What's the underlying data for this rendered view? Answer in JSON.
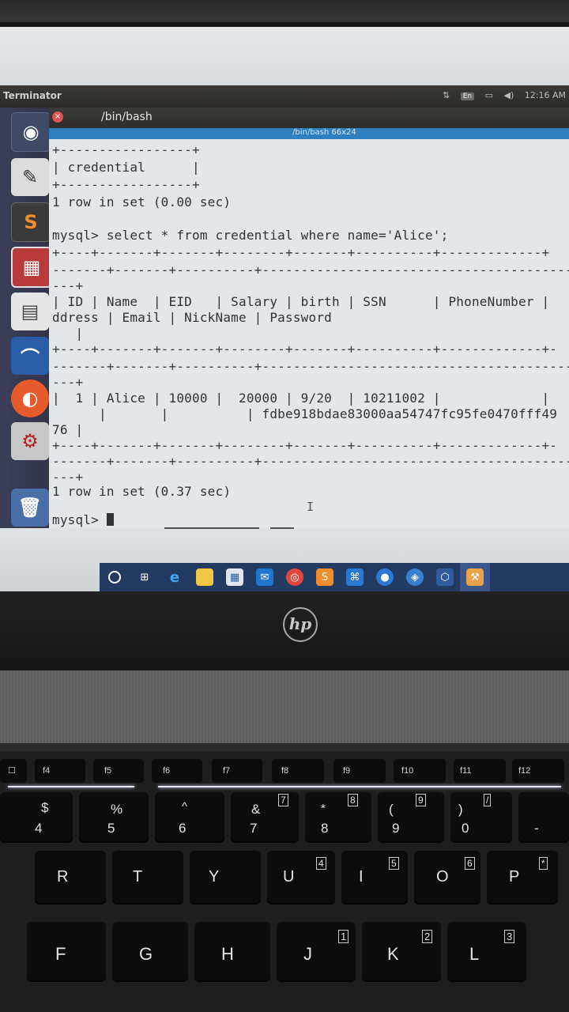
{
  "topbar": {
    "app_title": "Terminator",
    "lang_badge": "En",
    "clock": "12:16 AM"
  },
  "window": {
    "title": "/bin/bash",
    "inner_title": "/bin/bash 66x24"
  },
  "terminal": {
    "lines": [
      "+-----------------+",
      "| credential      |",
      "+-----------------+",
      "1 row in set (0.00 sec)",
      "",
      "mysql> select * from credential where name='Alice';",
      "+----+-------+-------+--------+-------+----------+-------------+",
      "-------+-------+----------+------------------------------------------",
      "---+",
      "| ID | Name  | EID   | Salary | birth | SSN      | PhoneNumber |",
      "ddress | Email | NickName | Password",
      "   |",
      "+----+-------+-------+--------+-------+----------+-------------+-",
      "-------+-------+----------+------------------------------------------",
      "---+",
      "|  1 | Alice | 10000 |  20000 | 9/20  | 10211002 |             |",
      "      |       |          | fdbe918bdae83000aa54747fc95fe0470fff49",
      "76 |",
      "+----+-------+-------+--------+-------+----------+-------------+-",
      "-------+-------+----------+------------------------------------------",
      "---+",
      "1 row in set (0.37 sec)",
      "",
      "mysql> "
    ]
  },
  "laptop": {
    "brand": "hp"
  },
  "keyboard": {
    "fkeys": [
      "f4",
      "f5",
      "f6",
      "f7",
      "f8",
      "f9",
      "f10",
      "f11",
      "f12"
    ],
    "num_row": [
      {
        "top": "$",
        "main": "4"
      },
      {
        "top": "%",
        "main": "5"
      },
      {
        "top": "^",
        "main": "6"
      },
      {
        "top": "&",
        "main": "7",
        "pad": "7"
      },
      {
        "top": "*",
        "main": "8",
        "pad": "8"
      },
      {
        "top": "(",
        "main": "9",
        "pad": "9"
      },
      {
        "top": ")",
        "main": "0",
        "pad": "/"
      },
      {
        "top": "",
        "main": "-"
      }
    ],
    "row2": [
      {
        "main": "R"
      },
      {
        "main": "T"
      },
      {
        "main": "Y"
      },
      {
        "main": "U",
        "pad": "4"
      },
      {
        "main": "I",
        "pad": "5"
      },
      {
        "main": "O",
        "pad": "6"
      },
      {
        "main": "P",
        "pad": "*"
      }
    ],
    "row3": [
      {
        "main": "F"
      },
      {
        "main": "G"
      },
      {
        "main": "H"
      },
      {
        "main": "J",
        "pad": "1"
      },
      {
        "main": "K",
        "pad": "2"
      },
      {
        "main": "L",
        "pad": "3"
      }
    ]
  },
  "colors": {
    "launcher": "#33364d",
    "taskbar": "#233a63",
    "terminal_bg": "#e4e7e9",
    "inner_header": "#2f7fbf"
  }
}
